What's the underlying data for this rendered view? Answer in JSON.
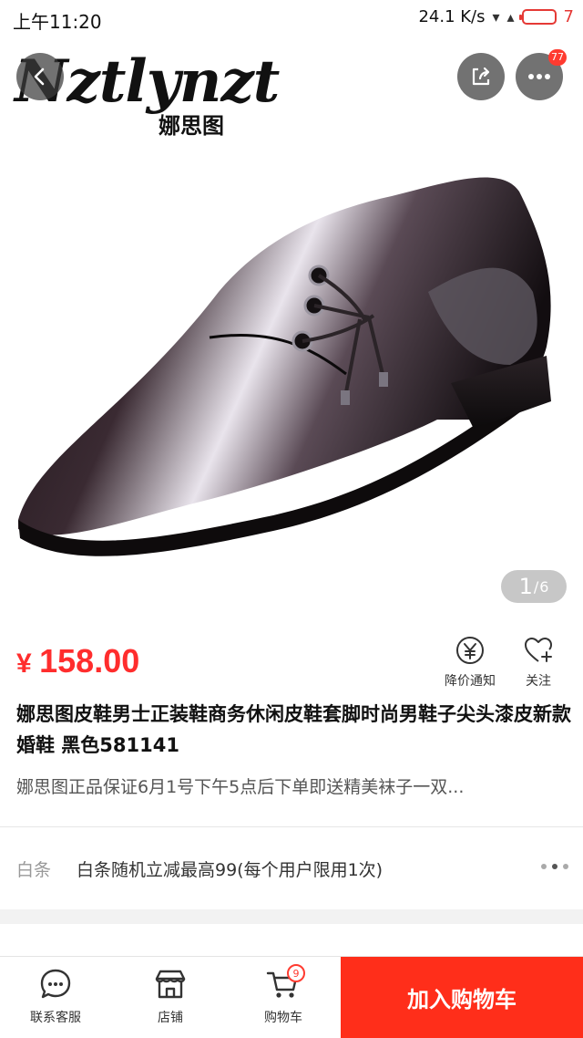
{
  "status_bar": {
    "time": "上午11:20",
    "network_speed": "24.1 K/s",
    "battery": "7"
  },
  "hero": {
    "brand_logo": "Nztlynzt",
    "brand_sub": "娜思图",
    "more_badge": "77",
    "page_current": "1",
    "page_separator": "/",
    "page_total": "6"
  },
  "product": {
    "price_symbol": "¥",
    "price": "158.00",
    "title": "娜思图皮鞋男士正装鞋商务休闲皮鞋套脚时尚男鞋子尖头漆皮新款婚鞋 黑色581141",
    "subtitle": "娜思图正品保证6月1号下午5点后下单即送精美袜子一双...",
    "actions": {
      "price_alert": "降价通知",
      "follow": "关注"
    }
  },
  "promo": {
    "label": "白条",
    "text": "白条随机立减最高99(每个用户限用1次)"
  },
  "bottom_bar": {
    "service": "联系客服",
    "store": "店铺",
    "cart": "购物车",
    "cart_badge": "9",
    "add_to_cart": "加入购物车"
  },
  "colors": {
    "accent": "#ff2e1a",
    "price": "#ff2d2d",
    "badge": "#ff3b30"
  }
}
